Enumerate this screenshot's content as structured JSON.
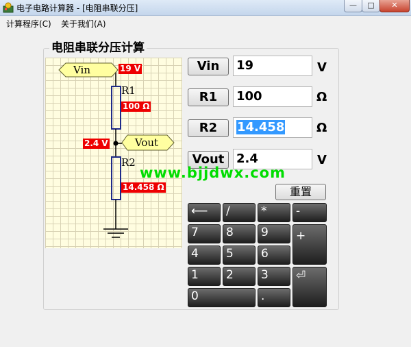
{
  "window": {
    "title": "电子电路计算器 - [电阻串联分压]",
    "minimize": "—",
    "maximize": "□",
    "close": "✕"
  },
  "menu": {
    "items": [
      "计算程序(C)",
      "关于我们(A)"
    ]
  },
  "panel": {
    "title": "电阻串联分压计算"
  },
  "schematic": {
    "vin_sign": "Vin",
    "vout_sign": "Vout",
    "r1_label": "R1",
    "r2_label": "R2",
    "vin_value": "19 V",
    "r1_value": "100 Ω",
    "vout_value": "2.4 V",
    "r2_value": "14.458 Ω"
  },
  "inputs": {
    "vin": {
      "button": "Vin",
      "value": "19",
      "unit": "V"
    },
    "r1": {
      "button": "R1",
      "value": "100",
      "unit": "Ω"
    },
    "r2": {
      "button": "R2",
      "value": "14.458",
      "unit": "Ω"
    },
    "vout": {
      "button": "Vout",
      "value": "2.4",
      "unit": "V"
    }
  },
  "reset_label": "重置",
  "watermark": "www.bjjdwx.com",
  "keypad": {
    "backspace": "⟵",
    "divide": "/",
    "multiply": "*",
    "minus": "-",
    "plus": "+",
    "k7": "7",
    "k8": "8",
    "k9": "9",
    "k4": "4",
    "k5": "5",
    "k6": "6",
    "k1": "1",
    "k2": "2",
    "k3": "3",
    "k0": "0",
    "dot": ".",
    "enter": "⏎"
  },
  "colors": {
    "accent_red": "#ee0000",
    "watermark_green": "#00dd00",
    "selection_blue": "#3399ff",
    "sign_fill": "#ffffa0"
  }
}
